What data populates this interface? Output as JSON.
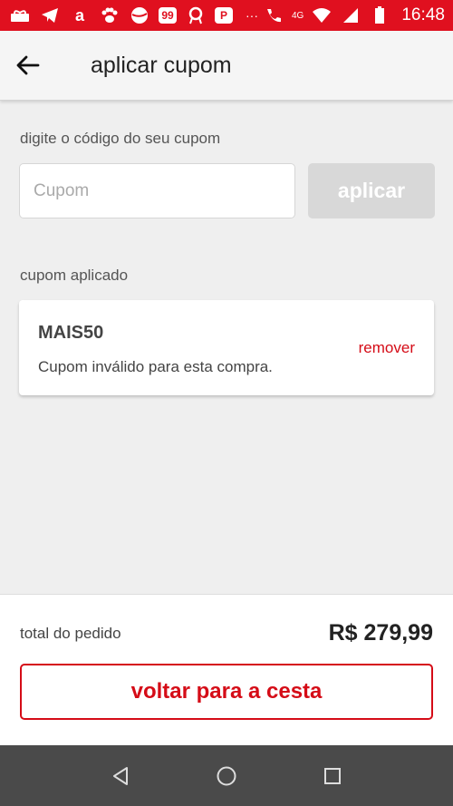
{
  "status_bar": {
    "time": "16:48",
    "network": "4G",
    "icons": [
      "gift-icon",
      "telegram-icon",
      "amazon-icon",
      "paw-icon",
      "pepsi-icon",
      "app99-icon",
      "pin-icon",
      "parking-icon",
      "more-dots-icon",
      "call-icon",
      "wifi-icon",
      "signal-icon",
      "battery-icon"
    ],
    "app99_text": "99",
    "parking_text": "P",
    "amazon_text": "a",
    "more_text": "···",
    "accent": "#e0101f"
  },
  "app_bar": {
    "title": "aplicar cupom",
    "back_icon": "arrow-left-icon"
  },
  "coupon_form": {
    "label": "digite o código do seu cupom",
    "input_placeholder": "Cupom",
    "input_value": "",
    "apply_label": "aplicar"
  },
  "applied": {
    "label": "cupom aplicado",
    "code": "MAIS50",
    "message": "Cupom inválido para esta compra.",
    "remove_label": "remover"
  },
  "summary": {
    "total_label": "total do pedido",
    "total_value": "R$ 279,99",
    "back_button_label": "voltar para a cesta"
  },
  "colors": {
    "brand_red": "#d50c17",
    "disabled_gray": "#d8d8d8"
  },
  "nav_bar": {
    "buttons": [
      "back-triangle-icon",
      "home-circle-icon",
      "recents-square-icon"
    ]
  }
}
